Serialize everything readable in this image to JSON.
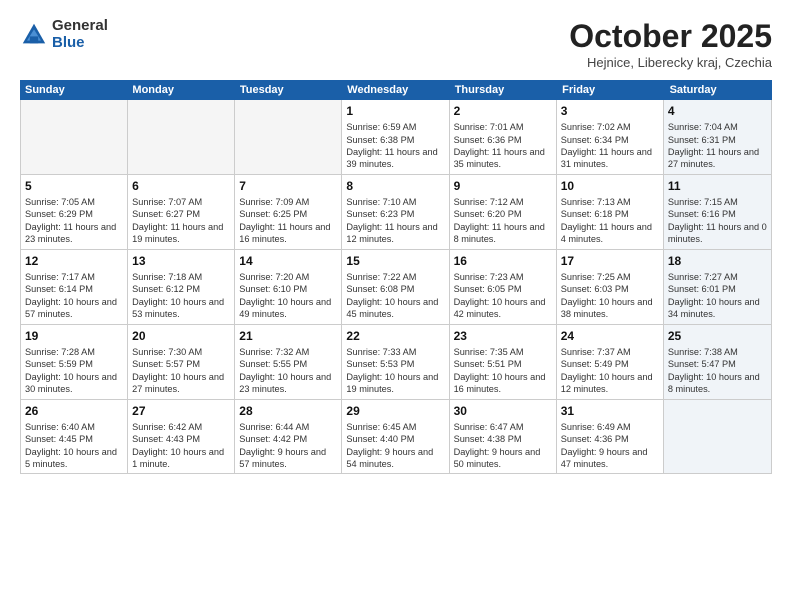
{
  "logo": {
    "general": "General",
    "blue": "Blue"
  },
  "header": {
    "month": "October 2025",
    "location": "Hejnice, Liberecky kraj, Czechia"
  },
  "weekdays": [
    "Sunday",
    "Monday",
    "Tuesday",
    "Wednesday",
    "Thursday",
    "Friday",
    "Saturday"
  ],
  "weeks": [
    [
      {
        "day": "",
        "sunrise": "",
        "sunset": "",
        "daylight": "",
        "empty": true
      },
      {
        "day": "",
        "sunrise": "",
        "sunset": "",
        "daylight": "",
        "empty": true
      },
      {
        "day": "",
        "sunrise": "",
        "sunset": "",
        "daylight": "",
        "empty": true
      },
      {
        "day": "1",
        "sunrise": "Sunrise: 6:59 AM",
        "sunset": "Sunset: 6:38 PM",
        "daylight": "Daylight: 11 hours and 39 minutes.",
        "empty": false
      },
      {
        "day": "2",
        "sunrise": "Sunrise: 7:01 AM",
        "sunset": "Sunset: 6:36 PM",
        "daylight": "Daylight: 11 hours and 35 minutes.",
        "empty": false
      },
      {
        "day": "3",
        "sunrise": "Sunrise: 7:02 AM",
        "sunset": "Sunset: 6:34 PM",
        "daylight": "Daylight: 11 hours and 31 minutes.",
        "empty": false
      },
      {
        "day": "4",
        "sunrise": "Sunrise: 7:04 AM",
        "sunset": "Sunset: 6:31 PM",
        "daylight": "Daylight: 11 hours and 27 minutes.",
        "empty": false,
        "saturday": true
      }
    ],
    [
      {
        "day": "5",
        "sunrise": "Sunrise: 7:05 AM",
        "sunset": "Sunset: 6:29 PM",
        "daylight": "Daylight: 11 hours and 23 minutes.",
        "empty": false
      },
      {
        "day": "6",
        "sunrise": "Sunrise: 7:07 AM",
        "sunset": "Sunset: 6:27 PM",
        "daylight": "Daylight: 11 hours and 19 minutes.",
        "empty": false
      },
      {
        "day": "7",
        "sunrise": "Sunrise: 7:09 AM",
        "sunset": "Sunset: 6:25 PM",
        "daylight": "Daylight: 11 hours and 16 minutes.",
        "empty": false
      },
      {
        "day": "8",
        "sunrise": "Sunrise: 7:10 AM",
        "sunset": "Sunset: 6:23 PM",
        "daylight": "Daylight: 11 hours and 12 minutes.",
        "empty": false
      },
      {
        "day": "9",
        "sunrise": "Sunrise: 7:12 AM",
        "sunset": "Sunset: 6:20 PM",
        "daylight": "Daylight: 11 hours and 8 minutes.",
        "empty": false
      },
      {
        "day": "10",
        "sunrise": "Sunrise: 7:13 AM",
        "sunset": "Sunset: 6:18 PM",
        "daylight": "Daylight: 11 hours and 4 minutes.",
        "empty": false
      },
      {
        "day": "11",
        "sunrise": "Sunrise: 7:15 AM",
        "sunset": "Sunset: 6:16 PM",
        "daylight": "Daylight: 11 hours and 0 minutes.",
        "empty": false,
        "saturday": true
      }
    ],
    [
      {
        "day": "12",
        "sunrise": "Sunrise: 7:17 AM",
        "sunset": "Sunset: 6:14 PM",
        "daylight": "Daylight: 10 hours and 57 minutes.",
        "empty": false
      },
      {
        "day": "13",
        "sunrise": "Sunrise: 7:18 AM",
        "sunset": "Sunset: 6:12 PM",
        "daylight": "Daylight: 10 hours and 53 minutes.",
        "empty": false
      },
      {
        "day": "14",
        "sunrise": "Sunrise: 7:20 AM",
        "sunset": "Sunset: 6:10 PM",
        "daylight": "Daylight: 10 hours and 49 minutes.",
        "empty": false
      },
      {
        "day": "15",
        "sunrise": "Sunrise: 7:22 AM",
        "sunset": "Sunset: 6:08 PM",
        "daylight": "Daylight: 10 hours and 45 minutes.",
        "empty": false
      },
      {
        "day": "16",
        "sunrise": "Sunrise: 7:23 AM",
        "sunset": "Sunset: 6:05 PM",
        "daylight": "Daylight: 10 hours and 42 minutes.",
        "empty": false
      },
      {
        "day": "17",
        "sunrise": "Sunrise: 7:25 AM",
        "sunset": "Sunset: 6:03 PM",
        "daylight": "Daylight: 10 hours and 38 minutes.",
        "empty": false
      },
      {
        "day": "18",
        "sunrise": "Sunrise: 7:27 AM",
        "sunset": "Sunset: 6:01 PM",
        "daylight": "Daylight: 10 hours and 34 minutes.",
        "empty": false,
        "saturday": true
      }
    ],
    [
      {
        "day": "19",
        "sunrise": "Sunrise: 7:28 AM",
        "sunset": "Sunset: 5:59 PM",
        "daylight": "Daylight: 10 hours and 30 minutes.",
        "empty": false
      },
      {
        "day": "20",
        "sunrise": "Sunrise: 7:30 AM",
        "sunset": "Sunset: 5:57 PM",
        "daylight": "Daylight: 10 hours and 27 minutes.",
        "empty": false
      },
      {
        "day": "21",
        "sunrise": "Sunrise: 7:32 AM",
        "sunset": "Sunset: 5:55 PM",
        "daylight": "Daylight: 10 hours and 23 minutes.",
        "empty": false
      },
      {
        "day": "22",
        "sunrise": "Sunrise: 7:33 AM",
        "sunset": "Sunset: 5:53 PM",
        "daylight": "Daylight: 10 hours and 19 minutes.",
        "empty": false
      },
      {
        "day": "23",
        "sunrise": "Sunrise: 7:35 AM",
        "sunset": "Sunset: 5:51 PM",
        "daylight": "Daylight: 10 hours and 16 minutes.",
        "empty": false
      },
      {
        "day": "24",
        "sunrise": "Sunrise: 7:37 AM",
        "sunset": "Sunset: 5:49 PM",
        "daylight": "Daylight: 10 hours and 12 minutes.",
        "empty": false
      },
      {
        "day": "25",
        "sunrise": "Sunrise: 7:38 AM",
        "sunset": "Sunset: 5:47 PM",
        "daylight": "Daylight: 10 hours and 8 minutes.",
        "empty": false,
        "saturday": true
      }
    ],
    [
      {
        "day": "26",
        "sunrise": "Sunrise: 6:40 AM",
        "sunset": "Sunset: 4:45 PM",
        "daylight": "Daylight: 10 hours and 5 minutes.",
        "empty": false
      },
      {
        "day": "27",
        "sunrise": "Sunrise: 6:42 AM",
        "sunset": "Sunset: 4:43 PM",
        "daylight": "Daylight: 10 hours and 1 minute.",
        "empty": false
      },
      {
        "day": "28",
        "sunrise": "Sunrise: 6:44 AM",
        "sunset": "Sunset: 4:42 PM",
        "daylight": "Daylight: 9 hours and 57 minutes.",
        "empty": false
      },
      {
        "day": "29",
        "sunrise": "Sunrise: 6:45 AM",
        "sunset": "Sunset: 4:40 PM",
        "daylight": "Daylight: 9 hours and 54 minutes.",
        "empty": false
      },
      {
        "day": "30",
        "sunrise": "Sunrise: 6:47 AM",
        "sunset": "Sunset: 4:38 PM",
        "daylight": "Daylight: 9 hours and 50 minutes.",
        "empty": false
      },
      {
        "day": "31",
        "sunrise": "Sunrise: 6:49 AM",
        "sunset": "Sunset: 4:36 PM",
        "daylight": "Daylight: 9 hours and 47 minutes.",
        "empty": false
      },
      {
        "day": "",
        "sunrise": "",
        "sunset": "",
        "daylight": "",
        "empty": true,
        "saturday": true
      }
    ]
  ]
}
